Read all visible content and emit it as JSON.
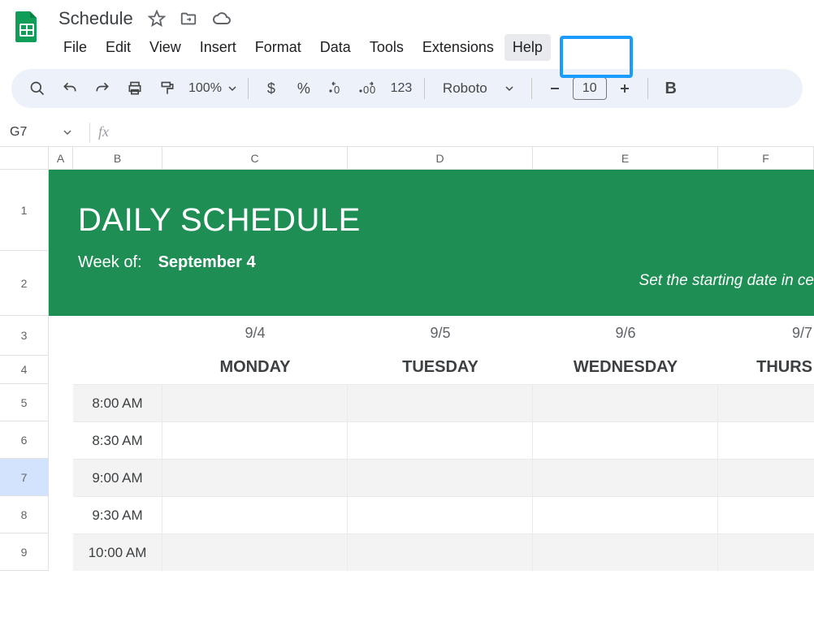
{
  "app": {
    "doc_title": "Schedule",
    "menus": [
      "File",
      "Edit",
      "View",
      "Insert",
      "Format",
      "Data",
      "Tools",
      "Extensions",
      "Help"
    ],
    "hovered_menu_index": 8
  },
  "toolbar": {
    "zoom": "100%",
    "font_family": "Roboto",
    "font_size": "10"
  },
  "namebox": {
    "ref": "G7"
  },
  "grid": {
    "columns": [
      "A",
      "B",
      "C",
      "D",
      "E",
      "F"
    ],
    "rows": [
      "1",
      "2",
      "3",
      "4",
      "5",
      "6",
      "7",
      "8",
      "9"
    ],
    "selected_row": "7"
  },
  "sheet": {
    "title": "DAILY SCHEDULE",
    "week_label": "Week of:",
    "week_value": "September 4",
    "hint": "Set the starting date in ce",
    "dates": [
      "9/4",
      "9/5",
      "9/6",
      "9/7"
    ],
    "days": [
      "MONDAY",
      "TUESDAY",
      "WEDNESDAY",
      "THURS"
    ],
    "times": [
      "8:00 AM",
      "8:30 AM",
      "9:00 AM",
      "9:30 AM",
      "10:00 AM"
    ]
  }
}
